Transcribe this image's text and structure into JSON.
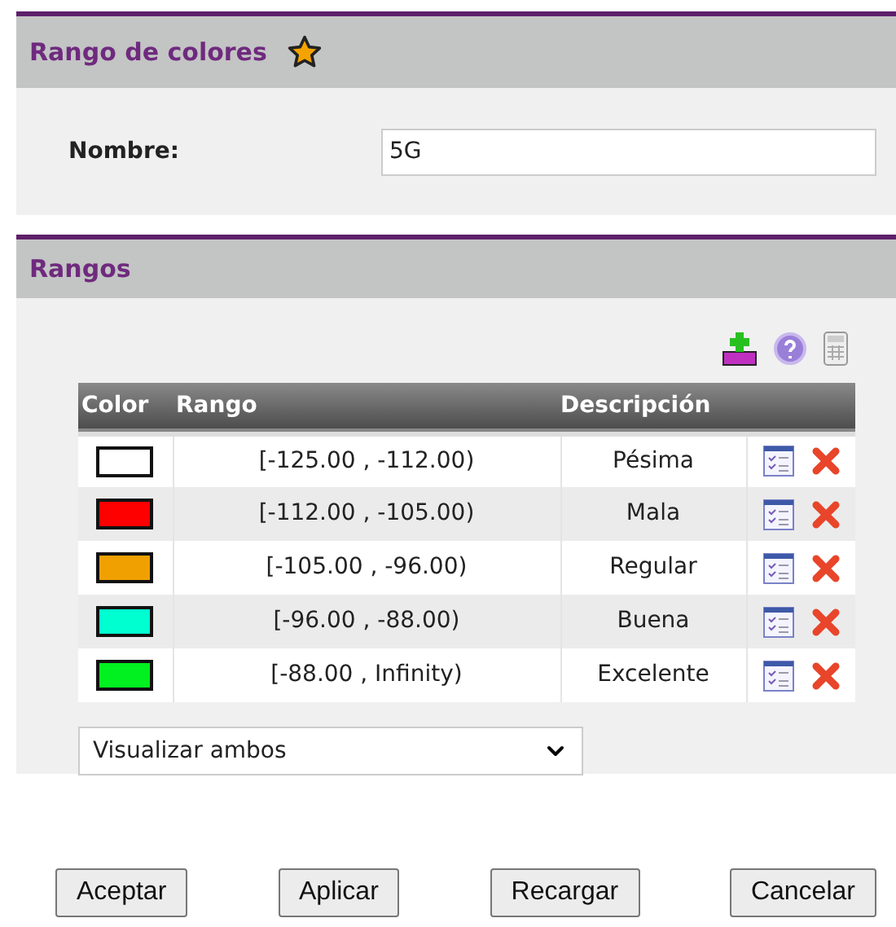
{
  "panel": {
    "title": "Rango de colores",
    "favorite": true,
    "name_label": "Nombre:",
    "name_value": "5G"
  },
  "ranges": {
    "title": "Rangos",
    "columns": [
      "Color",
      "Rango",
      "Descripción"
    ],
    "rows": [
      {
        "color": "#ffffff",
        "range": "[-125.00 , -112.00)",
        "description": "Pésima"
      },
      {
        "color": "#ff0000",
        "range": "[-112.00 , -105.00)",
        "description": "Mala"
      },
      {
        "color": "#f0a000",
        "range": "[-105.00 , -96.00)",
        "description": "Regular"
      },
      {
        "color": "#00ffd0",
        "range": "[-96.00 , -88.00)",
        "description": "Buena"
      },
      {
        "color": "#00f020",
        "range": "[-88.00 , Infinity)",
        "description": "Excelente"
      }
    ],
    "view_select": "Visualizar ambos"
  },
  "buttons": [
    "Aceptar",
    "Aplicar",
    "Recargar",
    "Cancelar"
  ]
}
